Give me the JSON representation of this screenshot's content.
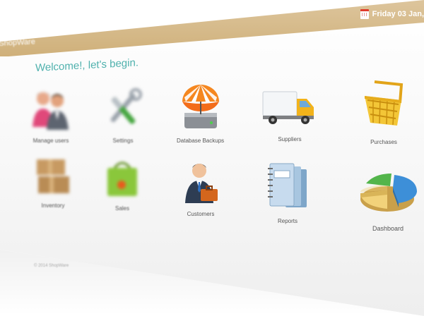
{
  "header": {
    "brand": "ShopWare",
    "date": "Friday 03 Jan,",
    "date_icon": "calendar-icon",
    "accent": "#d6b985"
  },
  "main": {
    "welcome": "Welcome!, let's begin.",
    "welcome_color": "#4fb1ad",
    "tiles": [
      {
        "label": "Manage users",
        "icon": "users-icon"
      },
      {
        "label": "Settings",
        "icon": "tools-icon"
      },
      {
        "label": "Database Backups",
        "icon": "database-backup-icon"
      },
      {
        "label": "Suppliers",
        "icon": "delivery-truck-icon"
      },
      {
        "label": "Purchases",
        "icon": "shopping-basket-icon"
      },
      {
        "label": "Inventory",
        "icon": "boxes-icon"
      },
      {
        "label": "Sales",
        "icon": "shopping-bag-icon"
      },
      {
        "label": "Customers",
        "icon": "businessman-icon"
      },
      {
        "label": "Reports",
        "icon": "notebooks-icon"
      },
      {
        "label": "Dashboard",
        "icon": "pie-chart-icon"
      }
    ]
  },
  "footer": {
    "text": "© 2014 ShopWare"
  }
}
